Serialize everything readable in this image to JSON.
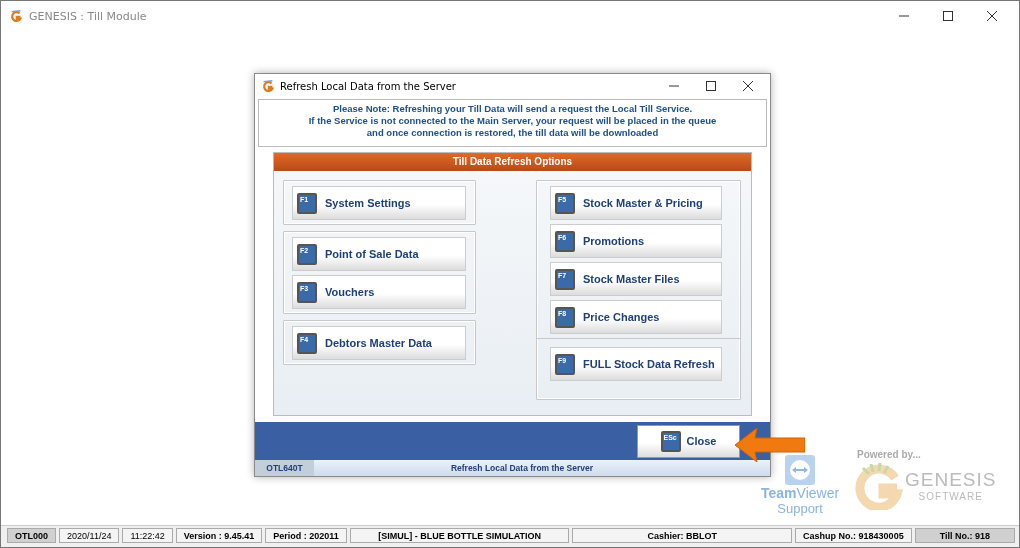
{
  "window": {
    "title": "GENESIS : Till Module"
  },
  "dialog": {
    "title": "Refresh Local Data from the Server",
    "note": [
      "Please Note: Refreshing your Till Data will send a request the Local Till Service.",
      "If the Service is not connected to the Main Server, your request will be placed in the queue",
      "and once connection is restored, the till data will be downloaded"
    ],
    "options_title": "Till Data Refresh Options",
    "left_groups": [
      [
        {
          "key": "F1",
          "label": "System Settings"
        }
      ],
      [
        {
          "key": "F2",
          "label": "Point of Sale Data"
        },
        {
          "key": "F3",
          "label": "Vouchers"
        }
      ],
      [
        {
          "key": "F4",
          "label": "Debtors Master Data"
        }
      ]
    ],
    "right_groups": [
      [
        {
          "key": "F5",
          "label": "Stock Master & Pricing"
        },
        {
          "key": "F6",
          "label": "Promotions"
        },
        {
          "key": "F7",
          "label": "Stock Master Files"
        },
        {
          "key": "F8",
          "label": "Price Changes"
        }
      ],
      [
        {
          "key": "F9",
          "label": "FULL Stock Data Refresh"
        }
      ]
    ],
    "close_button": {
      "key": "ESc",
      "label": "Close"
    },
    "status": {
      "code": "OTL640T",
      "text": "Refresh Local Data from the Server"
    }
  },
  "branding": {
    "teamviewer": "**Team**Viewer",
    "support": "Support",
    "powered_by": "Powered by...",
    "company": "GENESIS",
    "company_sub": "SOFTWARE"
  },
  "status_bar": [
    {
      "text": "OTL000",
      "kind": "code"
    },
    {
      "text": "2020/11/24",
      "kind": "plain"
    },
    {
      "text": "11:22:42",
      "kind": "plain"
    },
    {
      "text": "Version : 9.45.41",
      "kind": "bold"
    },
    {
      "text": "Period : 202011",
      "kind": "bold"
    },
    {
      "text": "[SIMUL] - BLUE BOTTLE SIMULATION",
      "kind": "wide"
    },
    {
      "text": "Cashier: BBLOT",
      "kind": "wide"
    },
    {
      "text": "Cashup No.: 918430005",
      "kind": "bold"
    },
    {
      "text": "Till No.: 918",
      "kind": "code"
    }
  ]
}
